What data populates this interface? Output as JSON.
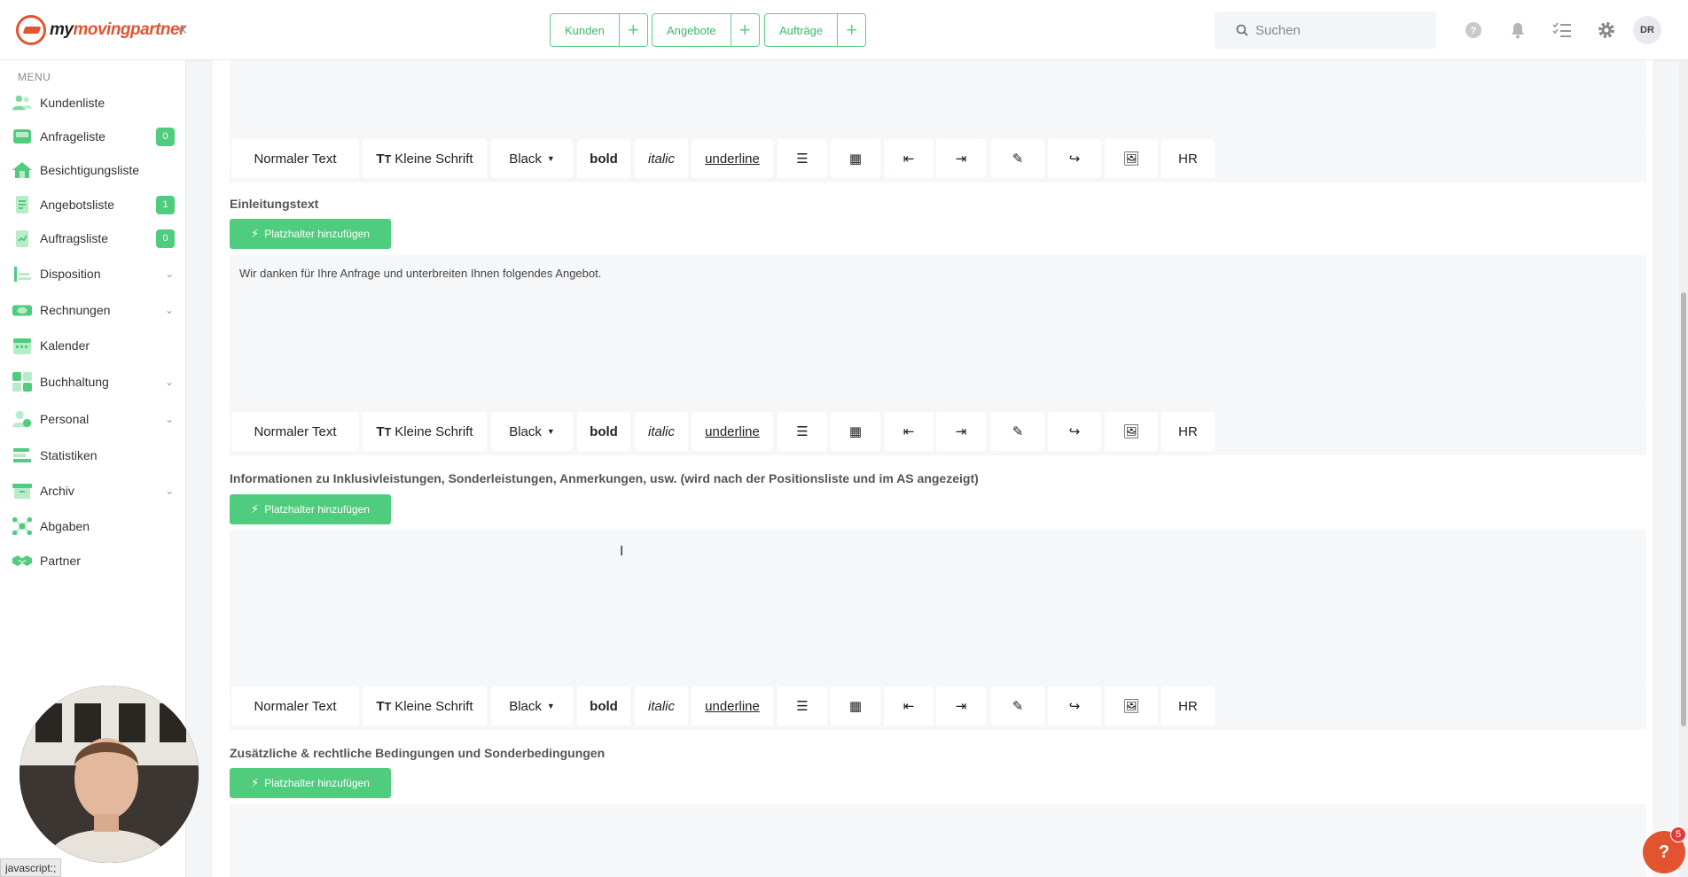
{
  "brand": {
    "logo_prefix": "my",
    "logo_name": "movingpartner",
    "accent": "#e2542f",
    "green": "#4fcc7e"
  },
  "topbar": {
    "quick": [
      {
        "label": "Kunden"
      },
      {
        "label": "Angebote"
      },
      {
        "label": "Aufträge"
      }
    ],
    "search_placeholder": "Suchen",
    "avatar": "DR"
  },
  "sidebar": {
    "menu_label": "MENU",
    "items": [
      {
        "label": "Kundenliste",
        "icon": "users-icon"
      },
      {
        "label": "Anfrageliste",
        "icon": "inbox-icon",
        "badge": "0"
      },
      {
        "label": "Besichtigungsliste",
        "icon": "house-icon"
      },
      {
        "label": "Angebotsliste",
        "icon": "document-icon",
        "badge": "1"
      },
      {
        "label": "Auftragsliste",
        "icon": "clipboard-icon",
        "badge": "0"
      },
      {
        "label": "Disposition",
        "icon": "chart-icon",
        "chevron": true
      },
      {
        "label": "Rechnungen",
        "icon": "money-icon",
        "chevron": true
      },
      {
        "label": "Kalender",
        "icon": "calendar-icon"
      },
      {
        "label": "Buchhaltung",
        "icon": "calculator-icon",
        "chevron": true
      },
      {
        "label": "Personal",
        "icon": "person-icon",
        "chevron": true
      },
      {
        "label": "Statistiken",
        "icon": "stats-icon"
      },
      {
        "label": "Archiv",
        "icon": "archive-icon",
        "chevron": true
      },
      {
        "label": "Abgaben",
        "icon": "network-icon"
      },
      {
        "label": "Partner",
        "icon": "handshake-icon"
      }
    ]
  },
  "toolbar": {
    "normal_text": "Normaler Text",
    "small_text": "Kleine Schrift",
    "color": "Black",
    "bold": "bold",
    "italic": "italic",
    "underline": "underline",
    "hr": "HR"
  },
  "sections": {
    "einleitung": {
      "label": "Einleitungstext",
      "button": "Platzhalter hinzufügen",
      "text": "Wir danken für Ihre Anfrage und unterbreiten Ihnen folgendes Angebot."
    },
    "informationen": {
      "label": "Informationen zu Inklusivleistungen, Sonderleistungen, Anmerkungen, usw. (wird nach der Positionsliste und im AS angezeigt)",
      "button": "Platzhalter hinzufügen",
      "text": ""
    },
    "bedingungen": {
      "label": "Zusätzliche & rechtliche Bedingungen und Sonderbedingungen",
      "button": "Platzhalter hinzufügen",
      "text": ""
    }
  },
  "status_link": "javascript:;",
  "help": {
    "label": "?",
    "badge": "5"
  }
}
